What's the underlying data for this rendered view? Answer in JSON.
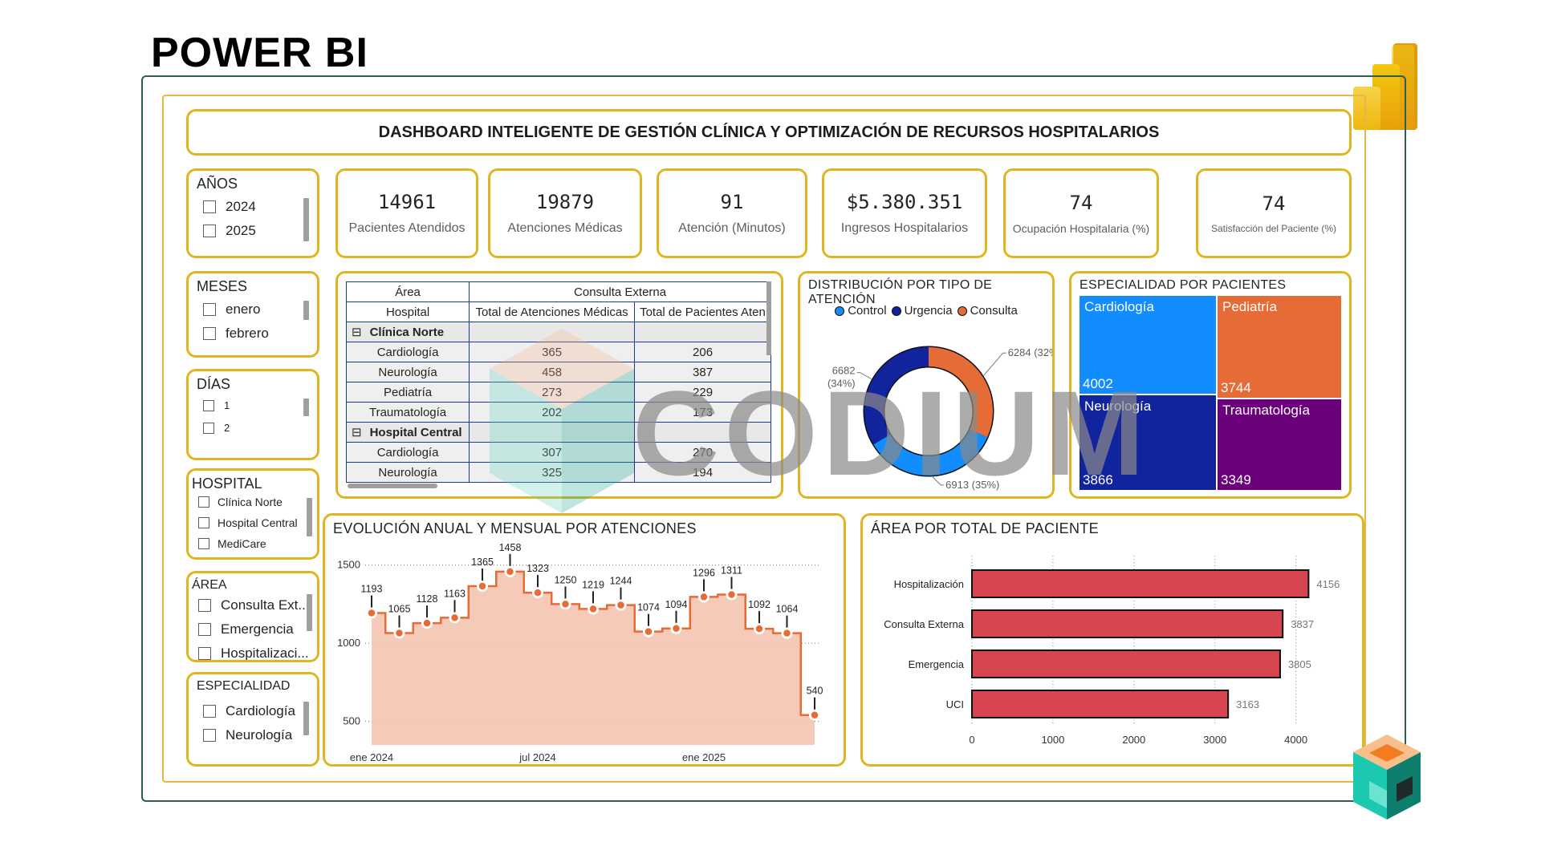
{
  "app": {
    "title": "POWER BI"
  },
  "dashboard": {
    "title": "DASHBOARD INTELIGENTE DE GESTIÓN CLÍNICA Y OPTIMIZACIÓN DE RECURSOS HOSPITALARIOS"
  },
  "kpis": [
    {
      "value": "14961",
      "label": "Pacientes Atendidos"
    },
    {
      "value": "19879",
      "label": "Atenciones Médicas"
    },
    {
      "value": "91",
      "label": "Atención (Minutos)"
    },
    {
      "value": "$5.380.351",
      "label": "Ingresos Hospitalarios"
    },
    {
      "value": "74",
      "label": "Ocupación Hospitalaria (%)"
    },
    {
      "value": "74",
      "label": "Satisfacción del Paciente (%)"
    }
  ],
  "slicers": {
    "years": {
      "title": "AÑOS",
      "items": [
        "2024",
        "2025"
      ]
    },
    "months": {
      "title": "MESES",
      "items": [
        "enero",
        "febrero"
      ]
    },
    "days": {
      "title": "DÍAS",
      "items": [
        "1",
        "2"
      ]
    },
    "hospital": {
      "title": "HOSPITAL",
      "items": [
        "Clínica Norte",
        "Hospital Central",
        "MediCare"
      ]
    },
    "area": {
      "title": "ÁREA",
      "items": [
        "Consulta Ext...",
        "Emergencia",
        "Hospitalizaci..."
      ]
    },
    "specialty": {
      "title": "ESPECIALIDAD",
      "items": [
        "Cardiología",
        "Neurología"
      ]
    }
  },
  "matrix": {
    "col_area": "Área",
    "col_area_value": "Consulta Externa",
    "col_hospital": "Hospital",
    "col_total_attentions": "Total de Atenciones Médicas",
    "col_total_patients": "Total de Pacientes Aten",
    "groups": [
      {
        "name": "Clínica Norte",
        "rows": [
          {
            "label": "Cardiología",
            "a": "365",
            "p": "206"
          },
          {
            "label": "Neurología",
            "a": "458",
            "p": "387"
          },
          {
            "label": "Pediatría",
            "a": "273",
            "p": "229"
          },
          {
            "label": "Traumatología",
            "a": "202",
            "p": "173"
          }
        ]
      },
      {
        "name": "Hospital Central",
        "rows": [
          {
            "label": "Cardiología",
            "a": "307",
            "p": "270"
          },
          {
            "label": "Neurología",
            "a": "325",
            "p": "194"
          }
        ]
      }
    ]
  },
  "colors": {
    "control": "#118dff",
    "urgencia": "#12239e",
    "consulta": "#e66c37",
    "cardiologia": "#118dff",
    "pediatria": "#e66c37",
    "neurologia": "#12239e",
    "traumatologia": "#6b007b",
    "bar": "#d64550",
    "area": "#f5c4b0",
    "line": "#e66c37",
    "gold": "#e0b51f"
  },
  "chart_data": [
    {
      "type": "donut",
      "title": "DISTRIBUCIÓN POR TIPO DE ATENCIÓN",
      "slices": [
        {
          "name": "Control",
          "value": 6913,
          "label": "6913 (35%)"
        },
        {
          "name": "Urgencia",
          "value": 6682,
          "label": "6682 (34%)"
        },
        {
          "name": "Consulta",
          "value": 6284,
          "label": "6284 (32%)"
        }
      ]
    },
    {
      "type": "treemap",
      "title": "ESPECIALIDAD POR PACIENTES",
      "items": [
        {
          "name": "Cardiología",
          "value": 4002
        },
        {
          "name": "Pediatría",
          "value": 3744
        },
        {
          "name": "Neurología",
          "value": 3866
        },
        {
          "name": "Traumatología",
          "value": 3349
        }
      ]
    },
    {
      "type": "area",
      "title": "EVOLUCIÓN ANUAL Y MENSUAL POR ATENCIONES",
      "x_ticks": [
        "ene 2024",
        "jul 2024",
        "ene 2025"
      ],
      "y_ticks": [
        500,
        1000,
        1500
      ],
      "ylim": [
        400,
        1560
      ],
      "values": [
        1193,
        1065,
        1128,
        1163,
        1365,
        1458,
        1323,
        1250,
        1219,
        1244,
        1074,
        1094,
        1296,
        1311,
        1092,
        1064,
        540
      ]
    },
    {
      "type": "bar",
      "orientation": "horizontal",
      "title": "ÁREA POR TOTAL DE PACIENTE",
      "categories": [
        "Hospitalización",
        "Consulta Externa",
        "Emergencia",
        "UCI"
      ],
      "values": [
        4156,
        3837,
        3805,
        3163
      ],
      "x_ticks": [
        0,
        1000,
        2000,
        3000,
        4000
      ],
      "xlim": [
        0,
        4400
      ]
    }
  ],
  "watermark": {
    "text": "CODIUM"
  }
}
